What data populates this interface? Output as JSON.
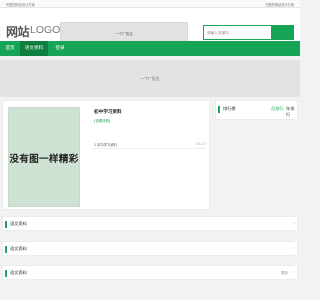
{
  "topbar": {
    "left_text": "完整的网站设计方案",
    "right_text": "完整的网站设计方案"
  },
  "header": {
    "logo_main": "网站",
    "logo_sub": "LOGO",
    "banner_text": "一个广告位",
    "search_placeholder": "请输入关键词"
  },
  "nav": {
    "items": [
      {
        "label": "首页"
      },
      {
        "label": "语文资料"
      },
      {
        "label": "登录"
      }
    ]
  },
  "ad": {
    "text": "一个广告位"
  },
  "featured": {
    "thumb_text": "没有图一样精彩",
    "title": "初中学习资料",
    "tag": "[查看详情]",
    "list": [
      {
        "title": "1 初中学习资料",
        "date": "05-13"
      }
    ]
  },
  "sidebar": {
    "title": "排行榜",
    "tab_active": "月排行",
    "tab_other": "年排行"
  },
  "sections": [
    {
      "title": "语文资料",
      "more": ""
    },
    {
      "title": "语文资料",
      "more": ""
    },
    {
      "title": "语文资料",
      "more": "更多"
    }
  ],
  "colors": {
    "accent": "#16a556",
    "accent_dark": "#0e7f3e",
    "thumb_bg": "#cde2d3"
  }
}
